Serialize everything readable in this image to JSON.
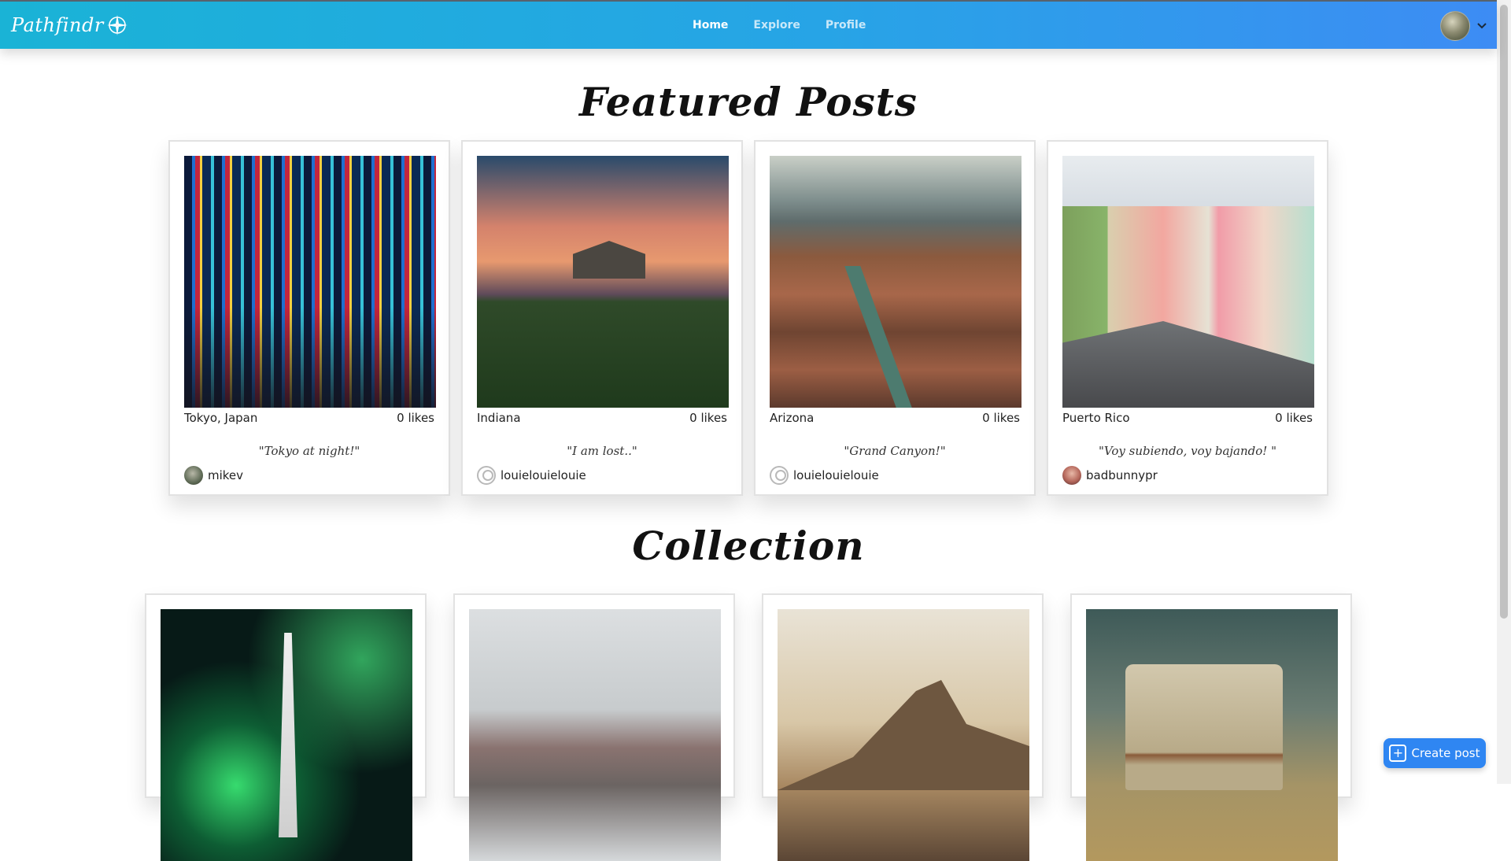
{
  "app": {
    "logo_text": "Pathfindr"
  },
  "nav": {
    "links": [
      {
        "label": "Home",
        "active": true
      },
      {
        "label": "Explore",
        "active": false
      },
      {
        "label": "Profile",
        "active": false
      }
    ],
    "avatar_icon": "user-avatar",
    "chevron_icon": "chevron-down-icon"
  },
  "featured": {
    "title": "Featured Posts",
    "posts": [
      {
        "location": "Tokyo, Japan",
        "likes": "0 likes",
        "caption": "\"Tokyo at night!\"",
        "author": "mikev"
      },
      {
        "location": "Indiana",
        "likes": "0 likes",
        "caption": "\"I am lost..\"",
        "author": "louielouielouie"
      },
      {
        "location": "Arizona",
        "likes": "0 likes",
        "caption": "\"Grand Canyon!\"",
        "author": "louielouielouie"
      },
      {
        "location": "Puerto Rico",
        "likes": "0 likes",
        "caption": "\"Voy subiendo, voy bajando! \"",
        "author": "badbunnypr"
      }
    ]
  },
  "collection": {
    "title": "Collection"
  },
  "actions": {
    "create_post": "Create post"
  },
  "colors": {
    "nav_start": "#1ab3d6",
    "nav_end": "#3d8cf4",
    "button": "#2f86f2"
  }
}
